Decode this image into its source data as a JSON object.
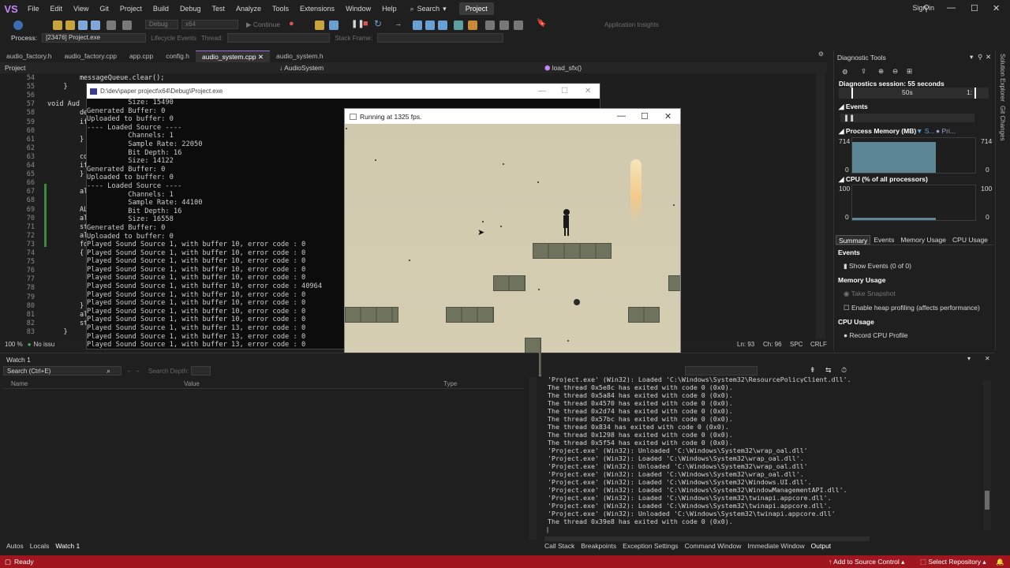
{
  "menu": {
    "logo": "VS",
    "items": [
      "File",
      "Edit",
      "View",
      "Git",
      "Project",
      "Build",
      "Debug",
      "Test",
      "Analyze",
      "Tools",
      "Extensions",
      "Window",
      "Help"
    ],
    "search_label": "Search",
    "project_badge": "Project",
    "signin": "Sign in"
  },
  "toolbar": {
    "config": "Debug",
    "platform": "x64",
    "continue_label": "Continue",
    "app_insights": "Application Insights",
    "process_label": "Process:",
    "process_value": "[23476] Project.exe",
    "lifecycle_label": "Lifecycle Events",
    "thread_label": "Thread:",
    "stackframe_label": "Stack Frame:"
  },
  "doc_tabs": [
    {
      "label": "audio_factory.h",
      "active": false
    },
    {
      "label": "audio_factory.cpp",
      "active": false
    },
    {
      "label": "app.cpp",
      "active": false
    },
    {
      "label": "config.h",
      "active": false
    },
    {
      "label": "audio_system.cpp",
      "active": true
    },
    {
      "label": "audio_system.h",
      "active": false
    }
  ],
  "navbar": {
    "scope": "Project",
    "class": "AudioSystem",
    "member": "load_sfx()"
  },
  "editor": {
    "lines": [
      {
        "n": "54",
        "t": "        messageQueue.clear();"
      },
      {
        "n": "55",
        "t": "    }"
      },
      {
        "n": "56",
        "t": ""
      },
      {
        "n": "57",
        "t": "void Aud"
      },
      {
        "n": "58",
        "t": "        devi"
      },
      {
        "n": "59",
        "t": "        if ("
      },
      {
        "n": "60",
        "t": ""
      },
      {
        "n": "61",
        "t": "        }"
      },
      {
        "n": "62",
        "t": ""
      },
      {
        "n": "63",
        "t": "        cont"
      },
      {
        "n": "64",
        "t": "        if ("
      },
      {
        "n": "65",
        "t": "        }"
      },
      {
        "n": "66",
        "t": ""
      },
      {
        "n": "67",
        "t": "        alcM"
      },
      {
        "n": "68",
        "t": ""
      },
      {
        "n": "69",
        "t": "        ALCi"
      },
      {
        "n": "70",
        "t": "        alcG"
      },
      {
        "n": "71",
        "t": "        std:"
      },
      {
        "n": "72",
        "t": "        alcG"
      },
      {
        "n": "73",
        "t": "        for"
      },
      {
        "n": "74",
        "t": "        {"
      },
      {
        "n": "75",
        "t": ""
      },
      {
        "n": "76",
        "t": ""
      },
      {
        "n": "77",
        "t": ""
      },
      {
        "n": "78",
        "t": ""
      },
      {
        "n": "79",
        "t": ""
      },
      {
        "n": "80",
        "t": "        }"
      },
      {
        "n": "81",
        "t": "        alGe"
      },
      {
        "n": "82",
        "t": "        std:"
      },
      {
        "n": "83",
        "t": "    }"
      }
    ],
    "zoom": "100 %",
    "issues": "No issu",
    "position": "Ln: 93",
    "column": "Ch: 96",
    "spc": "SPC",
    "crlf": "CRLF"
  },
  "console": {
    "title": "D:\\dev\\paper project\\x64\\Debug\\Project.exe",
    "lines": [
      "          Size: 15490",
      "Generated Buffer: 0",
      "Uploaded to buffer: 0",
      "---- Loaded Source ----",
      "          Channels: 1",
      "          Sample Rate: 22050",
      "          Bit Depth: 16",
      "          Size: 14122",
      "Generated Buffer: 0",
      "Uploaded to buffer: 0",
      "---- Loaded Source ----",
      "          Channels: 1",
      "          Sample Rate: 44100",
      "          Bit Depth: 16",
      "          Size: 16558",
      "Generated Buffer: 0",
      "Uploaded to buffer: 0",
      "Played Sound Source 1, with buffer 10, error code : 0",
      "Played Sound Source 1, with buffer 10, error code : 0",
      "Played Sound Source 1, with buffer 10, error code : 0",
      "Played Sound Source 1, with buffer 10, error code : 0",
      "Played Sound Source 1, with buffer 10, error code : 0",
      "Played Sound Source 1, with buffer 10, error code : 40964",
      "Played Sound Source 1, with buffer 10, error code : 0",
      "Played Sound Source 1, with buffer 10, error code : 0",
      "Played Sound Source 1, with buffer 10, error code : 0",
      "Played Sound Source 1, with buffer 10, error code : 0",
      "Played Sound Source 1, with buffer 13, error code : 0",
      "Played Sound Source 1, with buffer 13, error code : 0",
      "Played Sound Source 1, with buffer 13, error code : 0"
    ]
  },
  "game": {
    "title": "Running at 1325 fps."
  },
  "diagnostics": {
    "title": "Diagnostic Tools",
    "session": "Diagnostics session: 55 seconds",
    "timeline_label": "50s",
    "timeline_end": "1:",
    "events_header": "Events",
    "memory_header": "Process Memory (MB)",
    "memory_legend_1": "S...",
    "memory_legend_2": "Pri...",
    "memory_max": "714",
    "memory_min": "0",
    "memory_level": 0.88,
    "cpu_header": "CPU (% of all processors)",
    "cpu_max": "100",
    "cpu_min": "0",
    "cpu_level": 0.06,
    "tabs": [
      "Summary",
      "Events",
      "Memory Usage",
      "CPU Usage"
    ],
    "events_section": "Events",
    "show_events": "Show Events (0 of 0)",
    "memory_section": "Memory Usage",
    "take_snapshot": "Take Snapshot",
    "heap_profiling": "Enable heap profiling (affects performance)",
    "cpu_section": "CPU Usage",
    "record_cpu": "Record CPU Profile"
  },
  "right_strip": {
    "solution_explorer": "Solution Explorer",
    "git_changes": "Git Changes"
  },
  "watch": {
    "title": "Watch 1",
    "search_placeholder": "Search (Ctrl+E)",
    "search_depth": "Search Depth:",
    "col_name": "Name",
    "col_value": "Value",
    "col_type": "Type"
  },
  "output": {
    "lines": [
      "The thread 0x5e8c has exited with code 0 (0x0).",
      "The thread 0x5a84 has exited with code 0 (0x0).",
      "The thread 0x4570 has exited with code 0 (0x0).",
      "The thread 0x2d74 has exited with code 0 (0x0).",
      "The thread 0x57bc has exited with code 0 (0x0).",
      "The thread 0x834 has exited with code 0 (0x0).",
      "The thread 0x1298 has exited with code 0 (0x0).",
      "The thread 0x5f54 has exited with code 0 (0x0).",
      "'Project.exe' (Win32): Unloaded 'C:\\Windows\\System32\\wrap_oal.dll'",
      "'Project.exe' (Win32): Loaded 'C:\\Windows\\System32\\wrap_oal.dll'.",
      "'Project.exe' (Win32): Unloaded 'C:\\Windows\\System32\\wrap_oal.dll'",
      "'Project.exe' (Win32): Loaded 'C:\\Windows\\System32\\wrap_oal.dll'.",
      "'Project.exe' (Win32): Loaded 'C:\\Windows\\System32\\Windows.UI.dll'.",
      "'Project.exe' (Win32): Loaded 'C:\\Windows\\System32\\WindowManagementAPI.dll'.",
      "'Project.exe' (Win32): Loaded 'C:\\Windows\\System32\\twinapi.appcore.dll'.",
      "'Project.exe' (Win32): Loaded 'C:\\Windows\\System32\\twinapi.appcore.dll'.",
      "'Project.exe' (Win32): Unloaded 'C:\\Windows\\System32\\twinapi.appcore.dll'",
      "The thread 0x39e8 has exited with code 0 (0x0)."
    ],
    "top_partial": "'Project.exe' (Win32): Loaded 'C:\\Windows\\System32\\ResourcePolicyClient.dll'."
  },
  "bottom_tabs_left": [
    "Autos",
    "Locals",
    "Watch 1"
  ],
  "bottom_tabs_right": [
    "Call Stack",
    "Breakpoints",
    "Exception Settings",
    "Command Window",
    "Immediate Window",
    "Output"
  ],
  "status": {
    "ready": "Ready",
    "source_control": "Add to Source Control",
    "repository": "Select Repository"
  },
  "colors": {
    "accent": "#9a6fd8",
    "status_bar": "#a1151f",
    "memory_fill": "#5c8596",
    "cpu_fill": "#5c8596"
  }
}
